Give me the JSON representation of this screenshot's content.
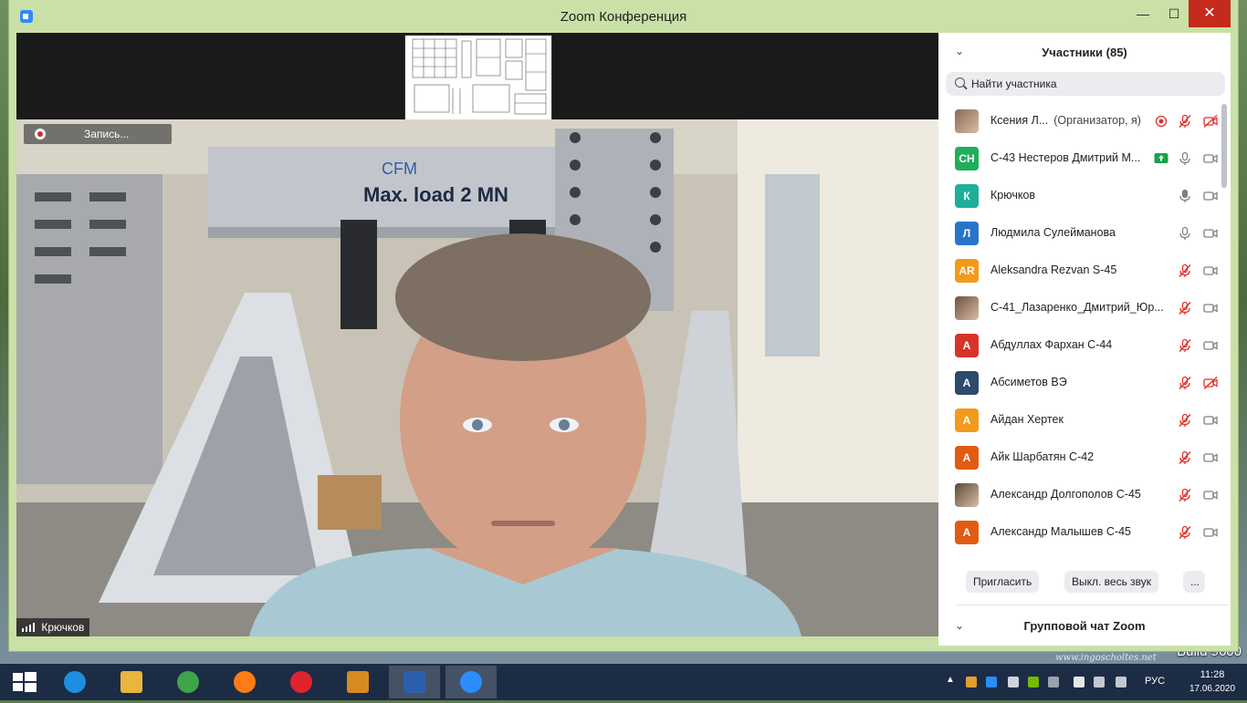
{
  "window": {
    "title": "Zoom Конференция",
    "min_glyph": "—",
    "max_glyph": "☐",
    "close_glyph": "✕"
  },
  "meeting": {
    "recording_label": "Запись...",
    "speaker_name": "Крючков",
    "video_banner_text": "Max. load 2 MN",
    "video_logo_text": "CFM"
  },
  "participants": {
    "header_title": "Участники (85)",
    "search_placeholder": "Найти участника",
    "items": [
      {
        "initials": "",
        "photo": true,
        "name": "Ксения Л...",
        "role": "(Организатор, я)",
        "avatar_color": "#8a6a55",
        "recording": true,
        "sharing": false,
        "mic": "muted",
        "cam": "off"
      },
      {
        "initials": "СН",
        "photo": false,
        "name": "С-43 Нестеров Дмитрий М...",
        "role": "",
        "avatar_color": "#1fae5a",
        "recording": false,
        "sharing": true,
        "mic": "on",
        "cam": "on"
      },
      {
        "initials": "К",
        "photo": false,
        "name": "Крючков",
        "role": "",
        "avatar_color": "#1fae9a",
        "recording": false,
        "sharing": false,
        "mic": "active",
        "cam": "on"
      },
      {
        "initials": "Л",
        "photo": false,
        "name": "Людмила Сулейманова",
        "role": "",
        "avatar_color": "#2775c9",
        "recording": false,
        "sharing": false,
        "mic": "on",
        "cam": "on"
      },
      {
        "initials": "AR",
        "photo": false,
        "name": "Aleksandra Rezvan S-45",
        "role": "",
        "avatar_color": "#f39a1c",
        "recording": false,
        "sharing": false,
        "mic": "muted",
        "cam": "on"
      },
      {
        "initials": "",
        "photo": true,
        "name": "С-41_Лазаренко_Дмитрий_Юр...",
        "role": "",
        "avatar_color": "#6d5140",
        "recording": false,
        "sharing": false,
        "mic": "muted",
        "cam": "on"
      },
      {
        "initials": "А",
        "photo": false,
        "name": "Абдуллах Фархан С-44",
        "role": "",
        "avatar_color": "#d8332b",
        "recording": false,
        "sharing": false,
        "mic": "muted",
        "cam": "on"
      },
      {
        "initials": "А",
        "photo": false,
        "name": "Абсиметов ВЭ",
        "role": "",
        "avatar_color": "#2e4a6d",
        "recording": false,
        "sharing": false,
        "mic": "muted",
        "cam": "off"
      },
      {
        "initials": "А",
        "photo": false,
        "name": "Айдан Хертек",
        "role": "",
        "avatar_color": "#f39a1c",
        "recording": false,
        "sharing": false,
        "mic": "muted",
        "cam": "on"
      },
      {
        "initials": "А",
        "photo": false,
        "name": "Айк Шарбатян С-42",
        "role": "",
        "avatar_color": "#e25b12",
        "recording": false,
        "sharing": false,
        "mic": "muted",
        "cam": "on"
      },
      {
        "initials": "",
        "photo": true,
        "name": "Александр Долгополов С-45",
        "role": "",
        "avatar_color": "#5b4a3a",
        "recording": false,
        "sharing": false,
        "mic": "muted",
        "cam": "on"
      },
      {
        "initials": "А",
        "photo": false,
        "name": "Александр Малышев С-45",
        "role": "",
        "avatar_color": "#e25b12",
        "recording": false,
        "sharing": false,
        "mic": "muted",
        "cam": "on"
      }
    ],
    "invite_label": "Пригласить",
    "mute_all_label": "Выкл. весь звук",
    "more_label": "...",
    "chat_title": "Групповой чат Zoom"
  },
  "colors": {
    "window_frame": "#c9e0a6",
    "mute_red": "#e0302b",
    "share_green": "#16a34a",
    "taskbar": "#1d2c45"
  },
  "taskbar": {
    "apps": [
      {
        "name": "internet-explorer",
        "color": "#1e8fe0",
        "active": false
      },
      {
        "name": "file-explorer",
        "color": "#e8b53d",
        "active": false
      },
      {
        "name": "chrome",
        "color": "#3fa44a",
        "active": false
      },
      {
        "name": "firefox",
        "color": "#ff7b15",
        "active": false
      },
      {
        "name": "opera",
        "color": "#e0232d",
        "active": false
      },
      {
        "name": "notes-app",
        "color": "#d88a22",
        "active": false
      },
      {
        "name": "word",
        "color": "#2b5fae",
        "active": true
      },
      {
        "name": "zoom",
        "color": "#2d8cff",
        "active": true
      }
    ],
    "language": "РУС",
    "time": "11:28",
    "date": "17.06.2020"
  },
  "desktop": {
    "build_text": "Build 9600",
    "watermark": "www.ingoscholtes.net"
  }
}
